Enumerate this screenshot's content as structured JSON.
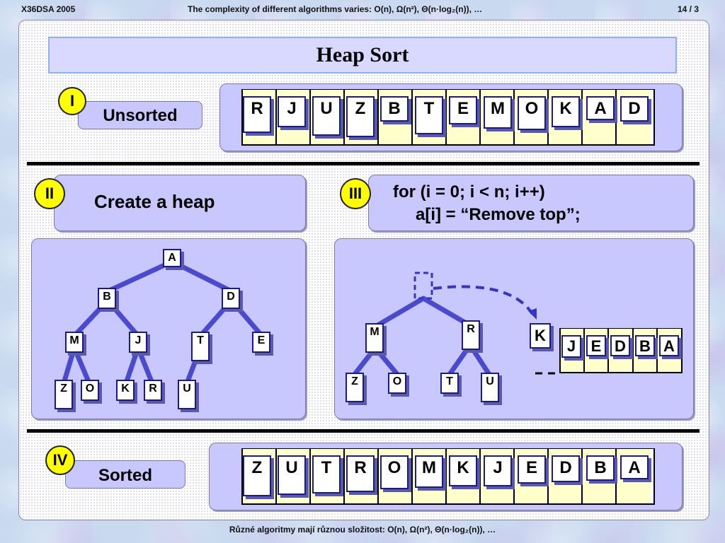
{
  "header": {
    "left": "X36DSA 2005",
    "center": "The complexity of different algorithms varies: O(n), Ω(n²), Θ(n·log₂(n)), …",
    "right": "14 / 3"
  },
  "title": "Heap Sort",
  "step1": {
    "badge": "I",
    "label": "Unsorted",
    "letters": [
      "R",
      "J",
      "U",
      "Z",
      "B",
      "T",
      "E",
      "M",
      "O",
      "K",
      "A",
      "D"
    ]
  },
  "step2": {
    "badge": "II",
    "label": "Create a heap",
    "heap": {
      "level0": [
        "A"
      ],
      "level1": [
        "B",
        "D"
      ],
      "level2": [
        "M",
        "J",
        "T",
        "E"
      ],
      "level3": [
        "Z",
        "O",
        "K",
        "R",
        "U"
      ]
    }
  },
  "step3": {
    "badge": "III",
    "code_line1": "for (i = 0; i < n; i++)",
    "code_line2": "a[i] = “Remove top”;",
    "tree": {
      "left": "M",
      "right": "R",
      "ll": "Z",
      "lr": "O",
      "rl": "T",
      "rr": "U"
    },
    "moving": "K",
    "sorted_part": [
      "J",
      "E",
      "D",
      "B",
      "A"
    ]
  },
  "step4": {
    "badge": "IV",
    "label": "Sorted",
    "letters": [
      "Z",
      "U",
      "T",
      "R",
      "O",
      "M",
      "K",
      "J",
      "E",
      "D",
      "B",
      "A"
    ]
  },
  "footer": "Různé algoritmy mají různou složitost: O(n), Ω(n²), Θ(n·log₂(n)), …"
}
